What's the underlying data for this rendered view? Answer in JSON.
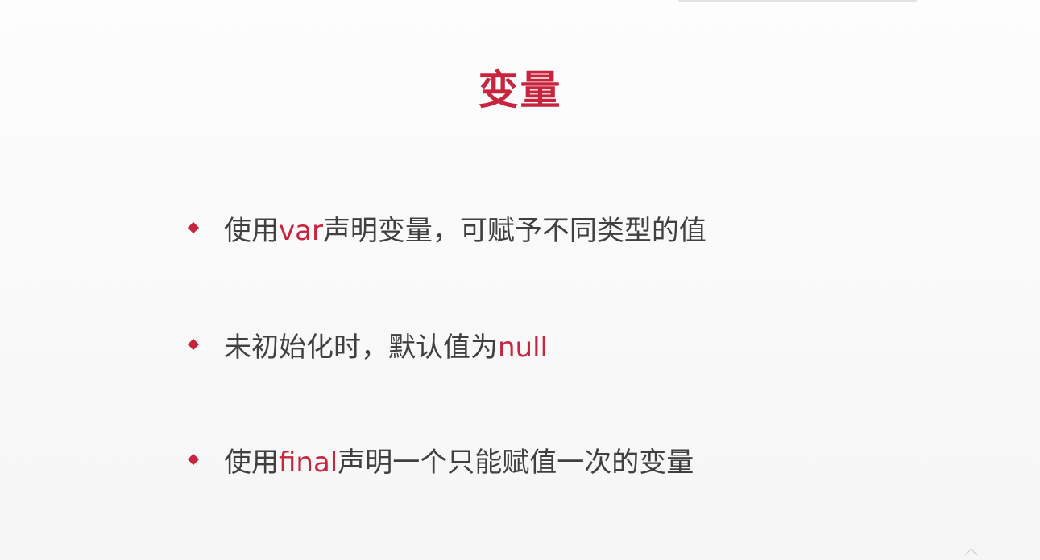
{
  "slide": {
    "title": "变量",
    "accent_color": "#c8243d",
    "bullets": [
      {
        "before": "使用",
        "highlight": "var",
        "after": "声明变量，可赋予不同类型的值"
      },
      {
        "before": "未初始化时，默认值为",
        "highlight": "null",
        "after": ""
      },
      {
        "before": "使用",
        "highlight": "final",
        "after": "声明一个只能赋值一次的变量"
      }
    ]
  }
}
